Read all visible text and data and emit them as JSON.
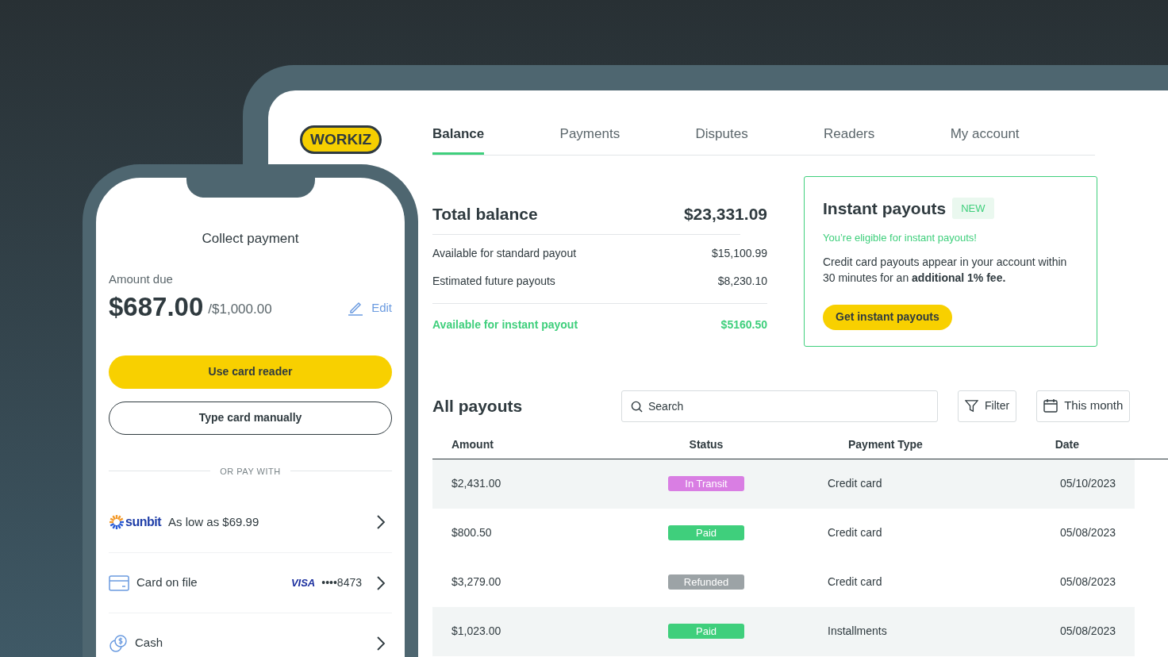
{
  "logo": "WORKIZ",
  "tabs": [
    {
      "label": "Balance",
      "selected": true
    },
    {
      "label": "Payments",
      "selected": false
    },
    {
      "label": "Disputes",
      "selected": false
    },
    {
      "label": "Readers",
      "selected": false
    },
    {
      "label": "My account",
      "selected": false
    }
  ],
  "balance": {
    "title": "Total balance",
    "total": "$23,331.09",
    "rows": [
      {
        "label": "Available for standard payout",
        "value": "$15,100.99"
      },
      {
        "label": "Estimated future payouts",
        "value": "$8,230.10"
      }
    ],
    "instant": {
      "label": "Available for instant payout",
      "value": "$5160.50"
    }
  },
  "instant_payouts": {
    "title": "Instant payouts",
    "badge": "NEW",
    "eligible": "You’re eligible for instant payouts!",
    "description": "Credit card payouts appear in your account within 30 minutes for an **additional 1% fee.**",
    "button": "Get instant payouts"
  },
  "payouts": {
    "title": "All payouts",
    "search": {
      "placeholder": "Search"
    },
    "filter": "Filter",
    "date_range": "This month",
    "columns": [
      "Amount",
      "Status",
      "Payment Type",
      "Date"
    ],
    "rows": [
      {
        "amount": "$2,431.00",
        "status": "In Transit",
        "color": "#d97ee3",
        "type": "Credit card",
        "date": "05/10/2023",
        "highlighted": true
      },
      {
        "amount": "$800.50",
        "status": "Paid",
        "color": "#3fcf7c",
        "type": "Credit card",
        "date": "05/08/2023",
        "highlighted": false
      },
      {
        "amount": "$3,279.00",
        "status": "Refunded",
        "color": "#9ca3a6",
        "type": "Credit card",
        "date": "05/08/2023",
        "highlighted": false
      },
      {
        "amount": "$1,023.00",
        "status": "Paid",
        "color": "#3fcf7c",
        "type": "Installments",
        "date": "05/08/2023",
        "highlighted": true
      }
    ]
  },
  "phone": {
    "title": "Collect payment",
    "amount_label": "Amount due",
    "amount": "$687.00",
    "total": "/$1,000.00",
    "edit": "Edit",
    "primary_button": "Use card reader",
    "secondary_button": "Type card manually",
    "divider": "OR PAY WITH",
    "methods": [
      {
        "kind": "sunbit",
        "brand": "sunbit",
        "label": "As low as $69.99"
      },
      {
        "kind": "card",
        "label": "Card on file",
        "brand": "VISA",
        "dots": "••••",
        "last4": "8473"
      },
      {
        "kind": "cash",
        "label": "Cash"
      }
    ]
  }
}
